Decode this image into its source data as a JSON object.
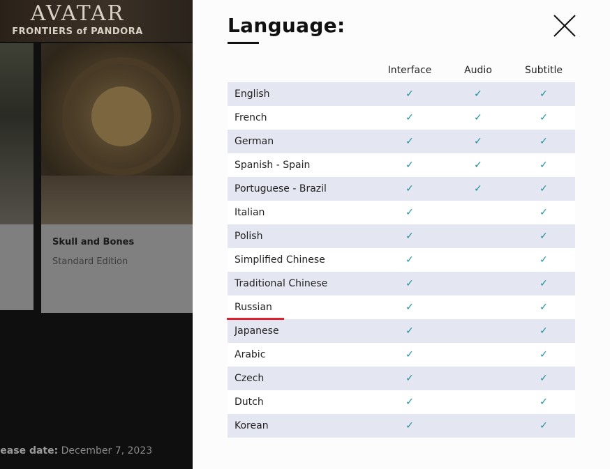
{
  "background": {
    "logo": {
      "title": "AVATAR",
      "subtitle": "FRONTIERS of PANDORA"
    },
    "card": {
      "title": "Skull and Bones",
      "edition": "Standard Edition"
    },
    "release": {
      "label": "elease date:",
      "value": "December 7, 2023"
    }
  },
  "modal": {
    "title": "Language:",
    "close_icon": "close-icon",
    "columns": [
      "Interface",
      "Audio",
      "Subtitle"
    ],
    "check_glyph": "✓",
    "accent_color": "#1a8f99",
    "highlight_color": "#e0202e",
    "hovered_language": "Russian",
    "languages": [
      {
        "name": "English",
        "interface": true,
        "audio": true,
        "subtitle": true
      },
      {
        "name": "French",
        "interface": true,
        "audio": true,
        "subtitle": true
      },
      {
        "name": "German",
        "interface": true,
        "audio": true,
        "subtitle": true
      },
      {
        "name": "Spanish - Spain",
        "interface": true,
        "audio": true,
        "subtitle": true
      },
      {
        "name": "Portuguese - Brazil",
        "interface": true,
        "audio": true,
        "subtitle": true
      },
      {
        "name": "Italian",
        "interface": true,
        "audio": false,
        "subtitle": true
      },
      {
        "name": "Polish",
        "interface": true,
        "audio": false,
        "subtitle": true
      },
      {
        "name": "Simplified Chinese",
        "interface": true,
        "audio": false,
        "subtitle": true
      },
      {
        "name": "Traditional Chinese",
        "interface": true,
        "audio": false,
        "subtitle": true
      },
      {
        "name": "Russian",
        "interface": true,
        "audio": false,
        "subtitle": true
      },
      {
        "name": "Japanese",
        "interface": true,
        "audio": false,
        "subtitle": true
      },
      {
        "name": "Arabic",
        "interface": true,
        "audio": false,
        "subtitle": true
      },
      {
        "name": "Czech",
        "interface": true,
        "audio": false,
        "subtitle": true
      },
      {
        "name": "Dutch",
        "interface": true,
        "audio": false,
        "subtitle": true
      },
      {
        "name": "Korean",
        "interface": true,
        "audio": false,
        "subtitle": true
      }
    ]
  }
}
